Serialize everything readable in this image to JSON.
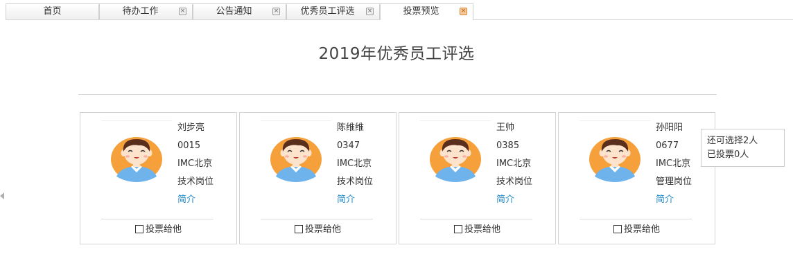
{
  "tabs": [
    {
      "label": "首页",
      "closable": false,
      "active": false
    },
    {
      "label": "待办工作",
      "closable": true,
      "active": false
    },
    {
      "label": "公告通知",
      "closable": true,
      "active": false
    },
    {
      "label": "优秀员工评选",
      "closable": true,
      "active": false
    },
    {
      "label": "投票预览",
      "closable": true,
      "active": true
    }
  ],
  "close_glyph": "×",
  "page_title": "2019年优秀员工评选",
  "vote_label": "投票给他",
  "intro_label": "简介",
  "candidates": [
    {
      "name": "刘步亮",
      "id": "0015",
      "location": "IMC北京",
      "position": "技术岗位"
    },
    {
      "name": "陈维维",
      "id": "0347",
      "location": "IMC北京",
      "position": "技术岗位"
    },
    {
      "name": "王帅",
      "id": "0385",
      "location": "IMC北京",
      "position": "技术岗位"
    },
    {
      "name": "孙阳阳",
      "id": "0677",
      "location": "IMC北京",
      "position": "管理岗位"
    }
  ],
  "vote_status": {
    "remaining": "还可选择2人",
    "voted": "已投票0人"
  },
  "colors": {
    "accent_link": "#1e88c8",
    "avatar_bg": "#f5a03a",
    "shirt": "#6fb3ec",
    "hair": "#5a2e1c",
    "skin": "#fde3cb"
  }
}
